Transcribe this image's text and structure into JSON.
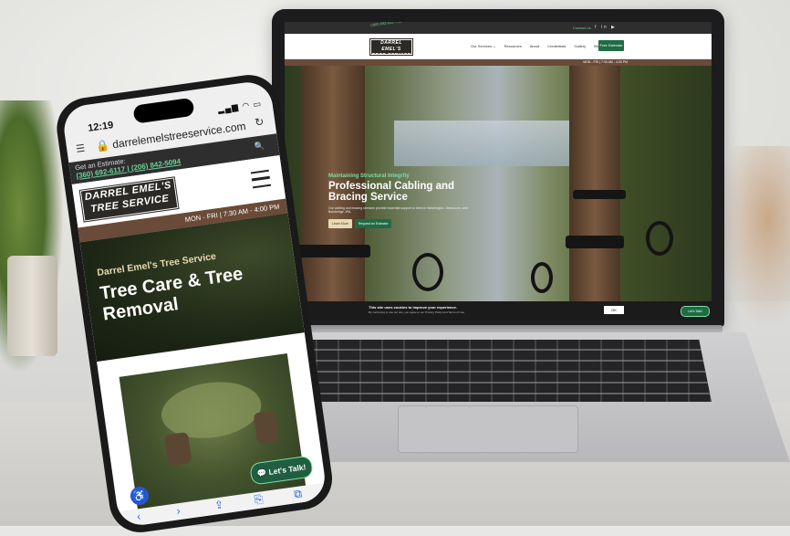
{
  "laptop": {
    "topbar_phone": "(360) 692-6117 | (206) 842-5094",
    "topbar_contact": "Contact Us",
    "topbar_socials": "f  in  ▶",
    "logo_line1": "DARREL EMEL'S",
    "logo_line2": "TREE SERVICE",
    "nav": [
      "Our Services ⌄",
      "Resources",
      "About",
      "Credentials",
      "Gallery",
      "Blog"
    ],
    "estimate_button": "Free Estimate",
    "hours": "MON - FRI | 7:30 AM - 4:00 PM",
    "hero_eyebrow": "Maintaining Structural Integrity",
    "hero_title": "Professional Cabling and Bracing Service",
    "hero_desc": "Our cabling and bracing services provide essential support to trees in Washington, Vancouver, and Bainbridge, WA.",
    "btn_learn": "Learn More",
    "btn_estimate": "Request an Estimate",
    "cookie_title": "This site uses cookies to improve your experience.",
    "cookie_text": "By continuing to use our site, you agree to our Privacy Policy and Terms of Use",
    "cookie_ok": "OK",
    "talk_button": "Let's Talk!"
  },
  "phone": {
    "time": "12:19",
    "signal": "▂▄▆ ◠ ▭",
    "url": "darrelemelstreeservice.com",
    "estimate_label": "Get an Estimate:",
    "estimate_phones": "(360) 692-6117 | (206) 842-5094",
    "logo_line1": "DARREL EMEL'S",
    "logo_line2": "TREE SERVICE",
    "hours": "MON - FRI | 7:30 AM - 4:00 PM",
    "hero_eyebrow": "Darrel Emel's Tree Service",
    "hero_title": "Tree Care & Tree Removal",
    "talk_button": "💬 Let's Talk!",
    "bar_back": "‹",
    "bar_forward": "›",
    "bar_share": "⇪",
    "bar_book": "⎘",
    "bar_tabs": "⧉"
  }
}
